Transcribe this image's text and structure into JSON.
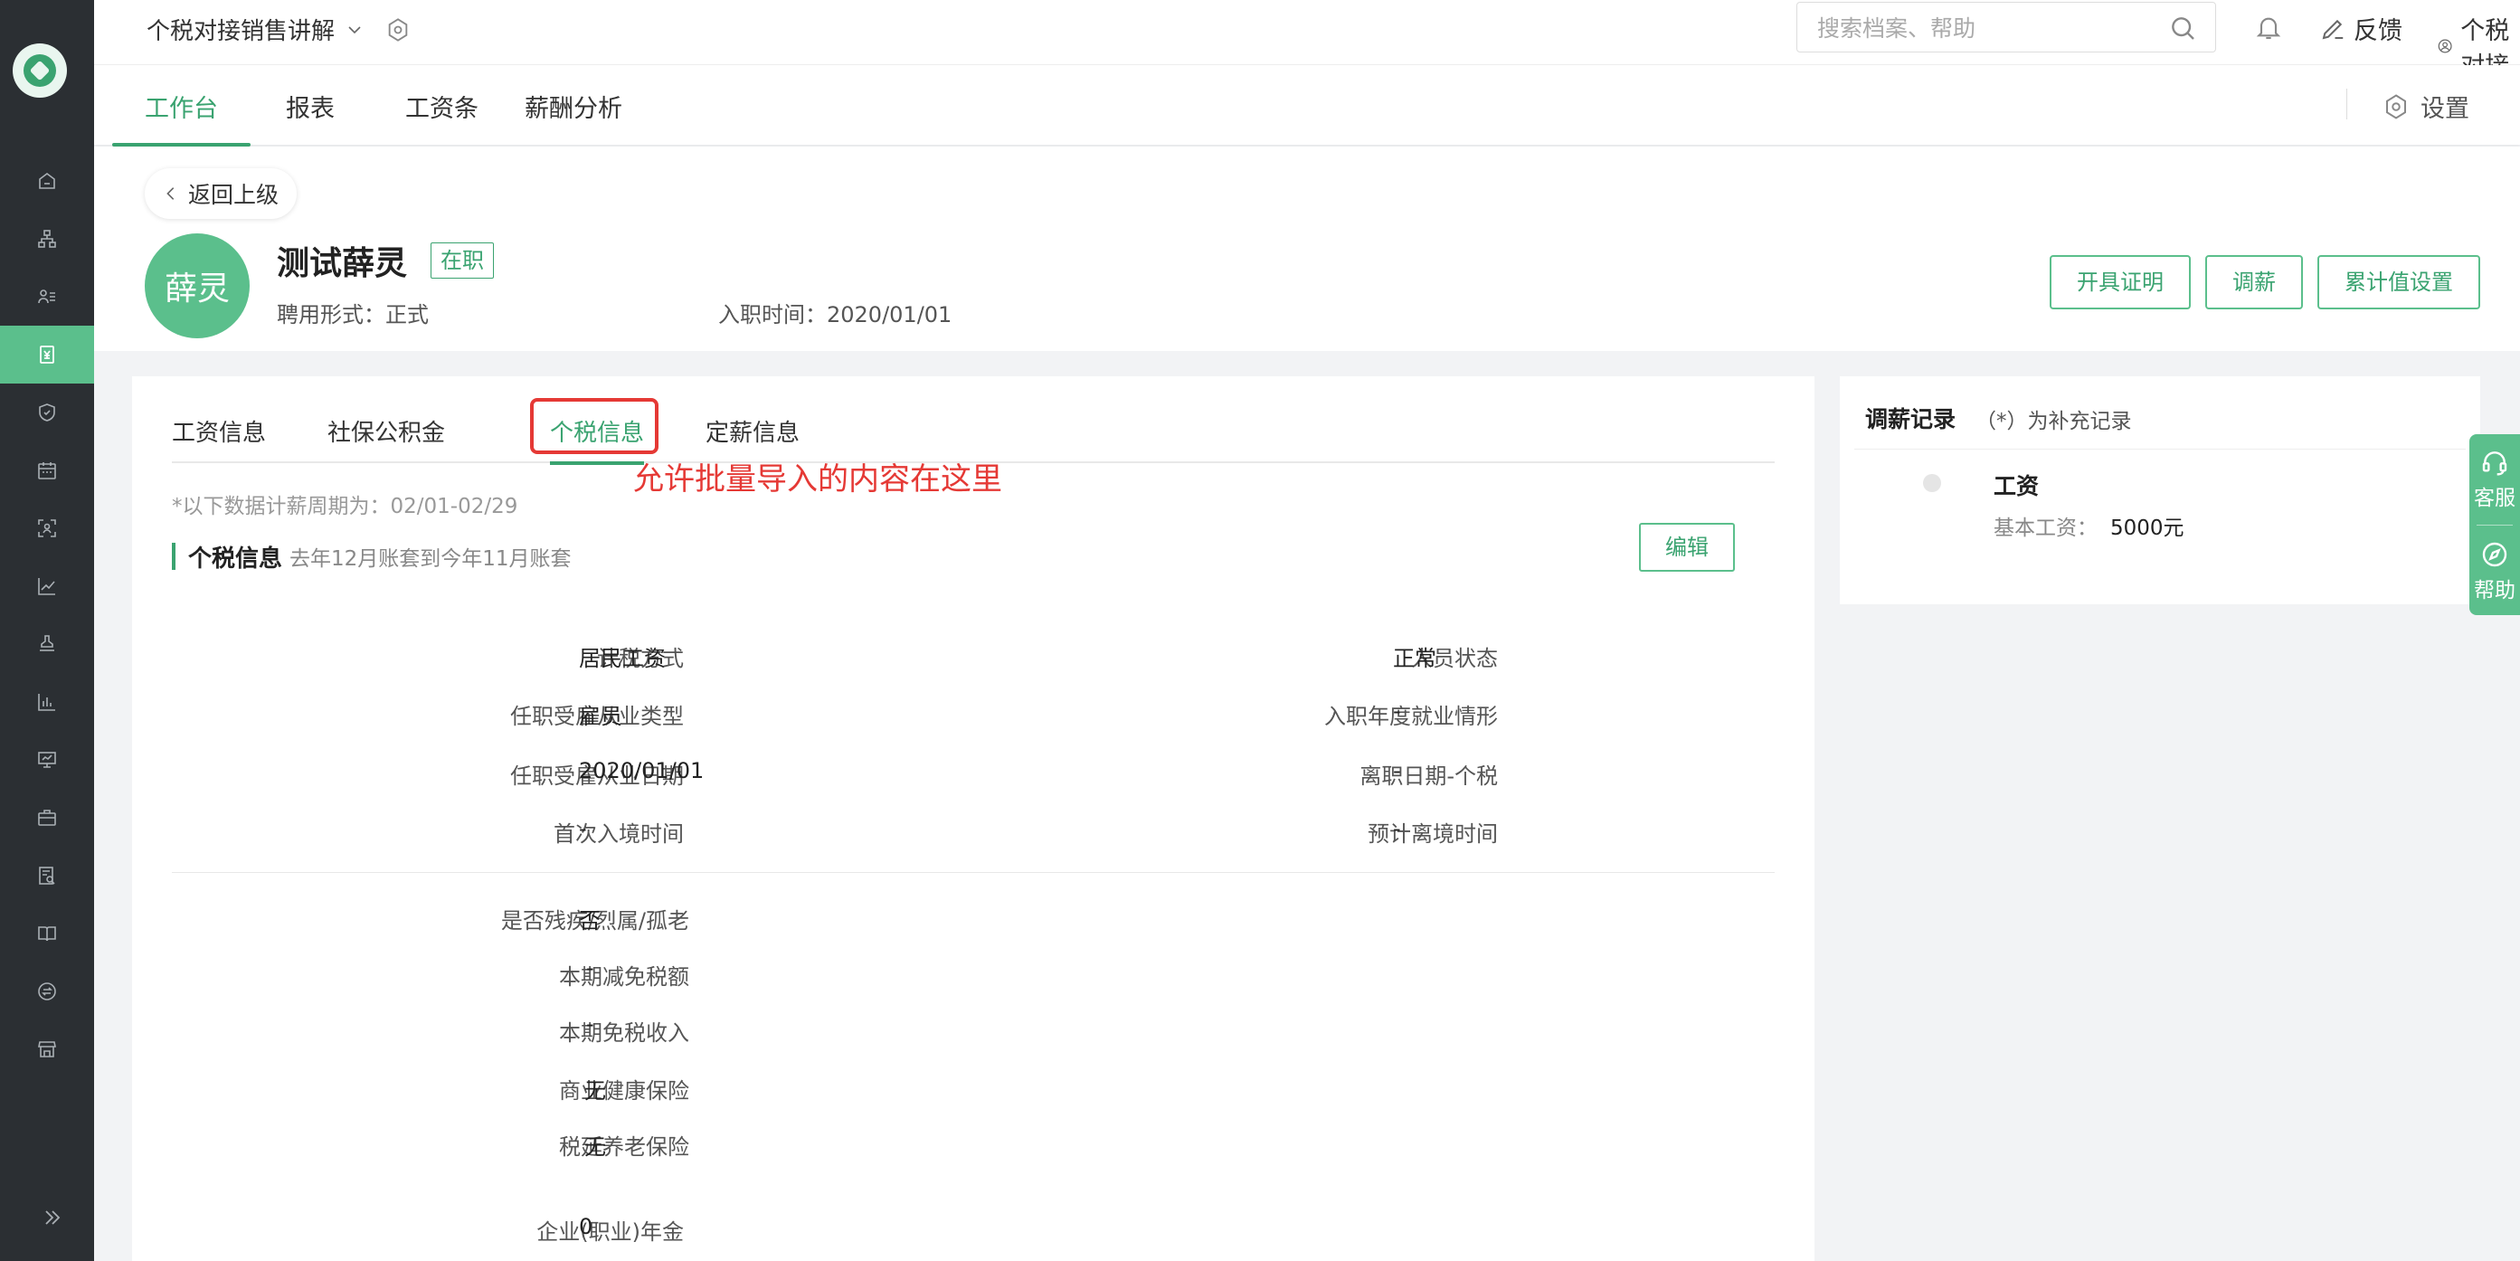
{
  "header": {
    "workspace_title": "个税对接销售讲解",
    "search_placeholder": "搜索档案、帮助",
    "feedback_label": "反馈",
    "user_label": "个税对接"
  },
  "tabs": {
    "workbench": "工作台",
    "reports": "报表",
    "payslip": "工资条",
    "salary_analysis": "薪酬分析",
    "settings": "设置"
  },
  "employee": {
    "back_label": "返回上级",
    "avatar_text": "薛灵",
    "name": "测试薛灵",
    "status": "在职",
    "employment_type_label": "聘用形式：",
    "employment_type": "正式",
    "hire_date_label": "入职时间：",
    "hire_date": "2020/01/01",
    "actions": [
      "开具证明",
      "调薪",
      "累计值设置"
    ]
  },
  "detail": {
    "subtabs": [
      "工资信息",
      "社保公积金",
      "个税信息",
      "定薪信息"
    ],
    "active_subtab": "个税信息",
    "annotation": "允许批量导入的内容在这里",
    "period_note": "*以下数据计薪周期为：02/01-02/29",
    "section_title": "个税信息",
    "section_subtitle": "去年12月账套到今年11月账套",
    "edit_label": "编辑",
    "fields_left": [
      {
        "label": "计税方式",
        "value": "居民工资"
      },
      {
        "label": "任职受雇从业类型",
        "value": "雇员"
      },
      {
        "label": "任职受雇从业日期",
        "value": "2020/01/01"
      },
      {
        "label": "首次入境时间",
        "value": "-"
      }
    ],
    "fields_right": [
      {
        "label": "人员状态",
        "value": "正常"
      },
      {
        "label": "入职年度就业情形",
        "value": "-"
      },
      {
        "label": "离职日期-个税",
        "value": "-"
      },
      {
        "label": "预计离境时间",
        "value": "-"
      }
    ],
    "fields_lower": [
      {
        "label": "是否残疾/烈属/孤老",
        "value": "否"
      },
      {
        "label": "本期减免税额",
        "value": "-"
      },
      {
        "label": "本期免税收入",
        "value": "-"
      },
      {
        "label": "商业健康保险",
        "value": "无"
      },
      {
        "label": "税延养老保险",
        "value": "无"
      },
      {
        "label": "企业(职业)年金",
        "value": "0"
      }
    ]
  },
  "side": {
    "title": "调薪记录",
    "subtitle": "（*）为补充记录",
    "item_title": "工资",
    "item_detail_label": "基本工资：",
    "item_detail_value": "5000元"
  },
  "float_help": {
    "service": "客服",
    "help": "帮助"
  },
  "colors": {
    "accent": "#3aa370",
    "accent_light": "#5bbf8c",
    "rail": "#2b2f33",
    "annotation": "#e53935"
  }
}
